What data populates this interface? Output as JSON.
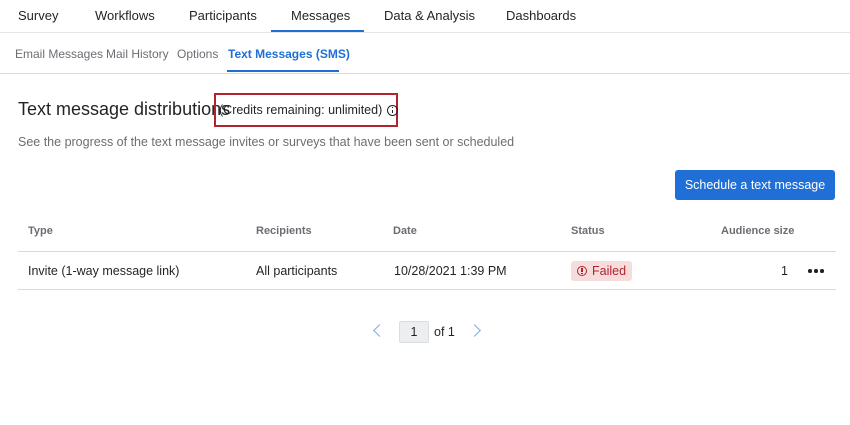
{
  "topnav": {
    "tabs": [
      {
        "label": "Survey"
      },
      {
        "label": "Workflows"
      },
      {
        "label": "Participants"
      },
      {
        "label": "Messages",
        "active": true
      },
      {
        "label": "Data & Analysis"
      },
      {
        "label": "Dashboards"
      }
    ]
  },
  "subnav": {
    "tabs": [
      {
        "label": "Email Messages"
      },
      {
        "label": "Mail History"
      },
      {
        "label": "Options"
      },
      {
        "label": "Text Messages (SMS)",
        "active": true
      }
    ]
  },
  "page": {
    "title": "Text message distributions",
    "credits": "(Credits remaining: unlimited)",
    "subtitle": "See the progress of the text message invites or surveys that have been sent or scheduled",
    "schedule_button": "Schedule a text message"
  },
  "table": {
    "columns": [
      "Type",
      "Recipients",
      "Date",
      "Status",
      "Audience size"
    ],
    "rows": [
      {
        "type": "Invite (1-way message link)",
        "recipients": "All participants",
        "date": "10/28/2021 1:39 PM",
        "status": "Failed",
        "audience_size": "1"
      }
    ]
  },
  "pagination": {
    "current_page": "1",
    "of_label": "of 1"
  },
  "colors": {
    "accent": "#1f6fd6",
    "highlight_box": "#b0242e",
    "status_failed_bg": "#f7dcdc",
    "status_failed_text": "#b0242e"
  },
  "icons": [
    "info-icon",
    "error-circle-icon",
    "more-horizontal-icon",
    "chevron-left-icon",
    "chevron-right-icon"
  ]
}
